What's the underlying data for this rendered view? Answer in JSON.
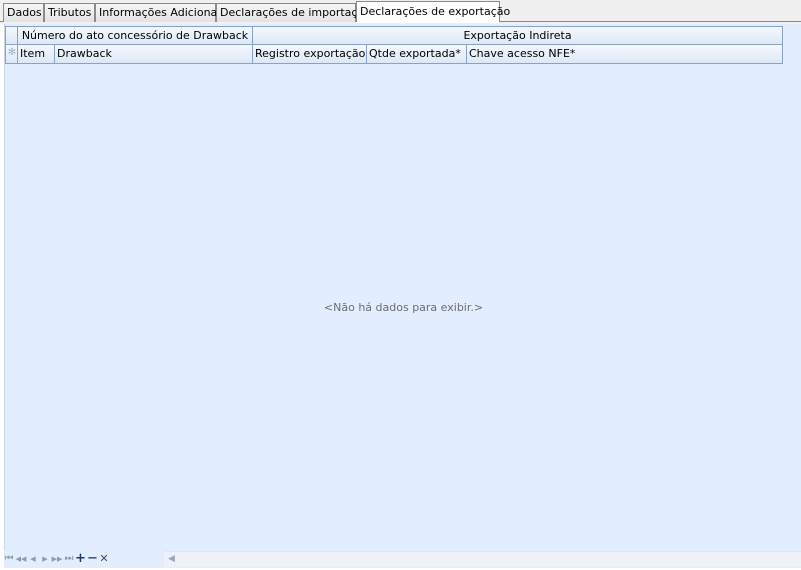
{
  "tabs": [
    {
      "label": "Dados"
    },
    {
      "label": "Tributos"
    },
    {
      "label": "Informações Adicionais"
    },
    {
      "label": "Declarações de importação"
    },
    {
      "label": "Declarações de exportação"
    }
  ],
  "grid": {
    "bands": {
      "drawback": "Número do ato concessório de Drawback",
      "indireta": "Exportação Indireta"
    },
    "columns": {
      "item": "Item",
      "drawback": "Drawback",
      "registro": "Registro exportação*",
      "qtde": "Qtde exportada*",
      "chave": "Chave acesso NFE*"
    },
    "new_row_indicator": "✻",
    "empty_text": "<Não há dados para exibir.>"
  },
  "navigator": {
    "first": "⏮",
    "prev_page": "◀◀",
    "prev": "◀",
    "next": "▶",
    "next_page": "▶▶",
    "last": "⏭",
    "add": "+",
    "remove": "−",
    "cancel": "✕"
  },
  "scrollbar": {
    "left_arrow": "◀"
  }
}
